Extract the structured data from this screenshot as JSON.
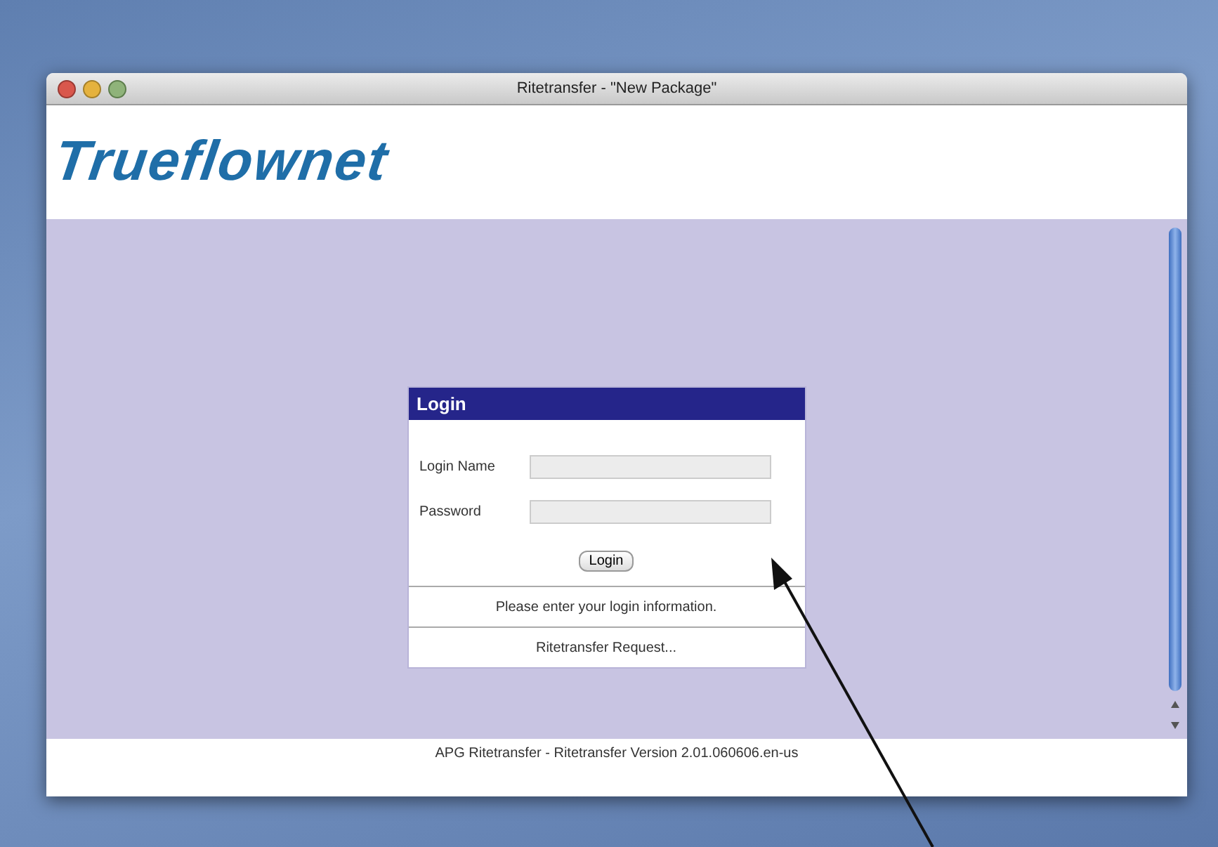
{
  "window": {
    "title": "Ritetransfer - \"New Package\""
  },
  "logo": "Trueflownet",
  "login": {
    "title": "Login",
    "fields": [
      {
        "label": "Login Name"
      },
      {
        "label": "Password"
      }
    ],
    "button": "Login",
    "message": "Please enter your login information.",
    "link": "Ritetransfer Request..."
  },
  "footer": "APG Ritetransfer  -  Ritetransfer Version 2.01.060606.en-us"
}
